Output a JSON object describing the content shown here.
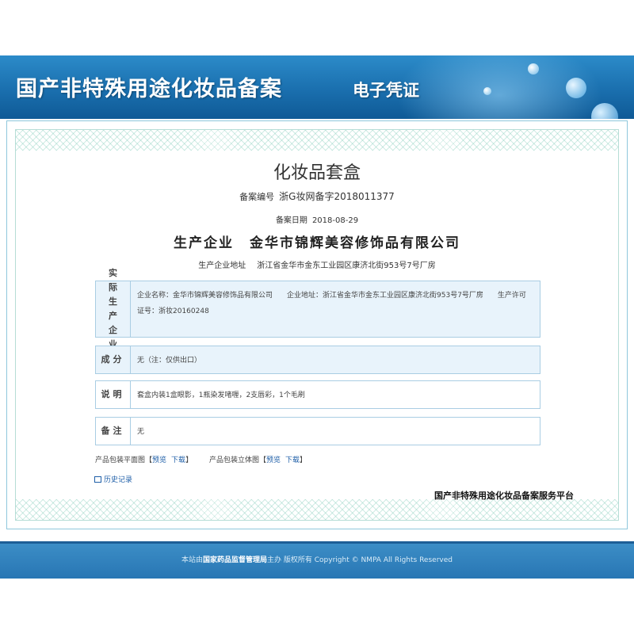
{
  "header": {
    "title": "国产非特殊用途化妆品备案",
    "subtitle": "电子凭证"
  },
  "certificate": {
    "product_name": "化妆品套盒",
    "registration_label": "备案编号",
    "registration_number": "浙G妆网备字2018011377",
    "date_label": "备案日期",
    "date": "2018-08-29",
    "producer_label": "生产企业",
    "producer_name": "金华市锦辉美容修饰品有限公司",
    "producer_address_label": "生产企业地址",
    "producer_address": "浙江省金华市金东工业园区康济北街953号7号厂房"
  },
  "sections": {
    "actual_producer": {
      "label": "实际生产企业",
      "name_field": "企业名称：金华市锦辉美容修饰品有限公司",
      "address_field": "企业地址：浙江省金华市金东工业园区康济北街953号7号厂房",
      "license_field": "生产许可证号：浙妆20160248"
    },
    "ingredients": {
      "label": "成分",
      "value": "无（注：仅供出口）"
    },
    "description": {
      "label": "说明",
      "value": "套盒内装1盒眼影，1瓶染发啫喱，2支唇彩，1个毛刷"
    },
    "remarks": {
      "label": "备注",
      "value": "无"
    }
  },
  "packaging": {
    "flat_label": "产品包装平面图",
    "stereo_label": "产品包装立体图",
    "preview": "预览",
    "download": "下载",
    "bracket_open": "【",
    "bracket_close": "】"
  },
  "history_link": "历史记录",
  "platform_name": "国产非特殊用途化妆品备案服务平台",
  "footer": {
    "prefix": "本站由",
    "org": "国家药品监督管理局",
    "suffix": "主办 版权所有 Copyright © NMPA All Rights Reserved"
  }
}
